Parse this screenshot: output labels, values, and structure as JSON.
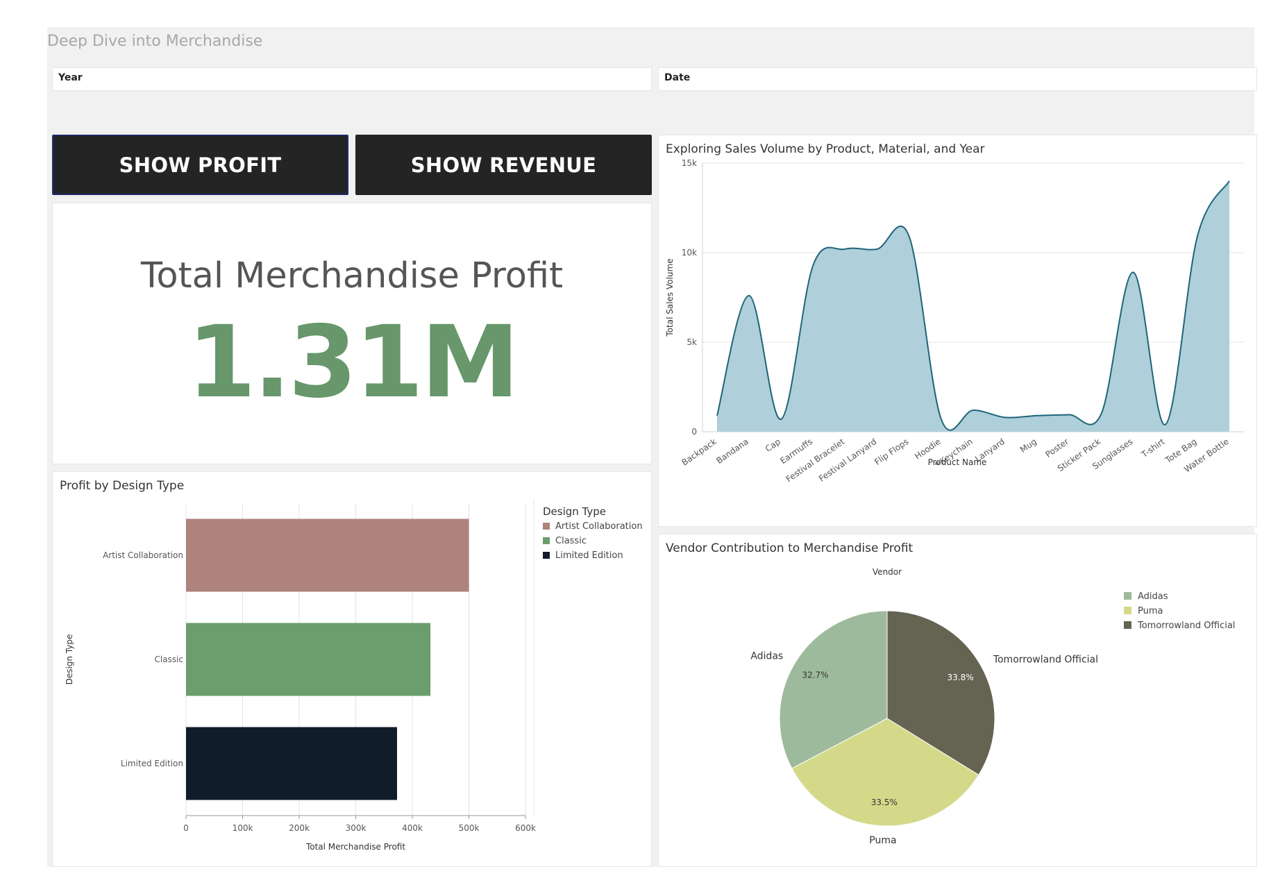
{
  "dashboard": {
    "title": "Deep Dive into Merchandise",
    "filters": {
      "year_label": "Year",
      "date_label": "Date"
    },
    "buttons": {
      "profit_label": "SHOW PROFIT",
      "revenue_label": "SHOW REVENUE"
    },
    "kpi": {
      "label": "Total Merchandise Profit",
      "value": "1.31M",
      "color": "#67976b"
    }
  },
  "colors": {
    "area_fill": "#afcfda",
    "area_line": "#1e6478",
    "artist_collaboration": "#ad837b",
    "classic": "#6b9d6d",
    "limited_edition": "#111c2a",
    "adidas": "#9eba9c",
    "puma": "#d4d98a",
    "tomorrowland": "#656453"
  },
  "chart_data": [
    {
      "type": "area",
      "title": "Exploring Sales Volume by Product, Material, and Year",
      "xlabel": "Product Name",
      "ylabel": "Total Sales Volume",
      "ylim": [
        0,
        15000
      ],
      "yticks": [
        0,
        5000,
        10000,
        15000
      ],
      "ytick_labels": [
        "0",
        "5k",
        "10k",
        "15k"
      ],
      "grid": true,
      "categories": [
        "Backpack",
        "Bandana",
        "Cap",
        "Earmuffs",
        "Festival Bracelet",
        "Festival Lanyard",
        "Flip Flops",
        "Hoodie",
        "Keychain",
        "Lanyard",
        "Mug",
        "Poster",
        "Sticker Pack",
        "Sunglasses",
        "T-shirt",
        "Tote Bag",
        "Water Bottle"
      ],
      "values": [
        900,
        7600,
        700,
        9300,
        10200,
        10200,
        10900,
        700,
        1200,
        800,
        900,
        950,
        1000,
        8900,
        400,
        10900,
        14000
      ]
    },
    {
      "type": "bar",
      "orientation": "horizontal",
      "title": "Profit by Design Type",
      "xlabel": "Total Merchandise Profit",
      "ylabel": "Design Type",
      "xlim": [
        0,
        600000
      ],
      "xticks": [
        0,
        100000,
        200000,
        300000,
        400000,
        500000,
        600000
      ],
      "xtick_labels": [
        "0",
        "100k",
        "200k",
        "300k",
        "400k",
        "500k",
        "600k"
      ],
      "grid": true,
      "categories": [
        "Artist Collaboration",
        "Classic",
        "Limited Edition"
      ],
      "values": [
        500000,
        432000,
        373000
      ],
      "legend": {
        "title": "Design Type",
        "position": "right",
        "entries": [
          "Artist Collaboration",
          "Classic",
          "Limited Edition"
        ]
      }
    },
    {
      "type": "pie",
      "title": "Vendor Contribution to Merchandise Profit",
      "subtitle": "Vendor",
      "slices": [
        {
          "label": "Tomorrowland Official",
          "value": 33.8,
          "pct_label": "33.8%"
        },
        {
          "label": "Puma",
          "value": 33.5,
          "pct_label": "33.5%"
        },
        {
          "label": "Adidas",
          "value": 32.7,
          "pct_label": "32.7%"
        }
      ],
      "legend": {
        "position": "top-right",
        "entries": [
          "Adidas",
          "Puma",
          "Tomorrowland Official"
        ]
      }
    }
  ]
}
